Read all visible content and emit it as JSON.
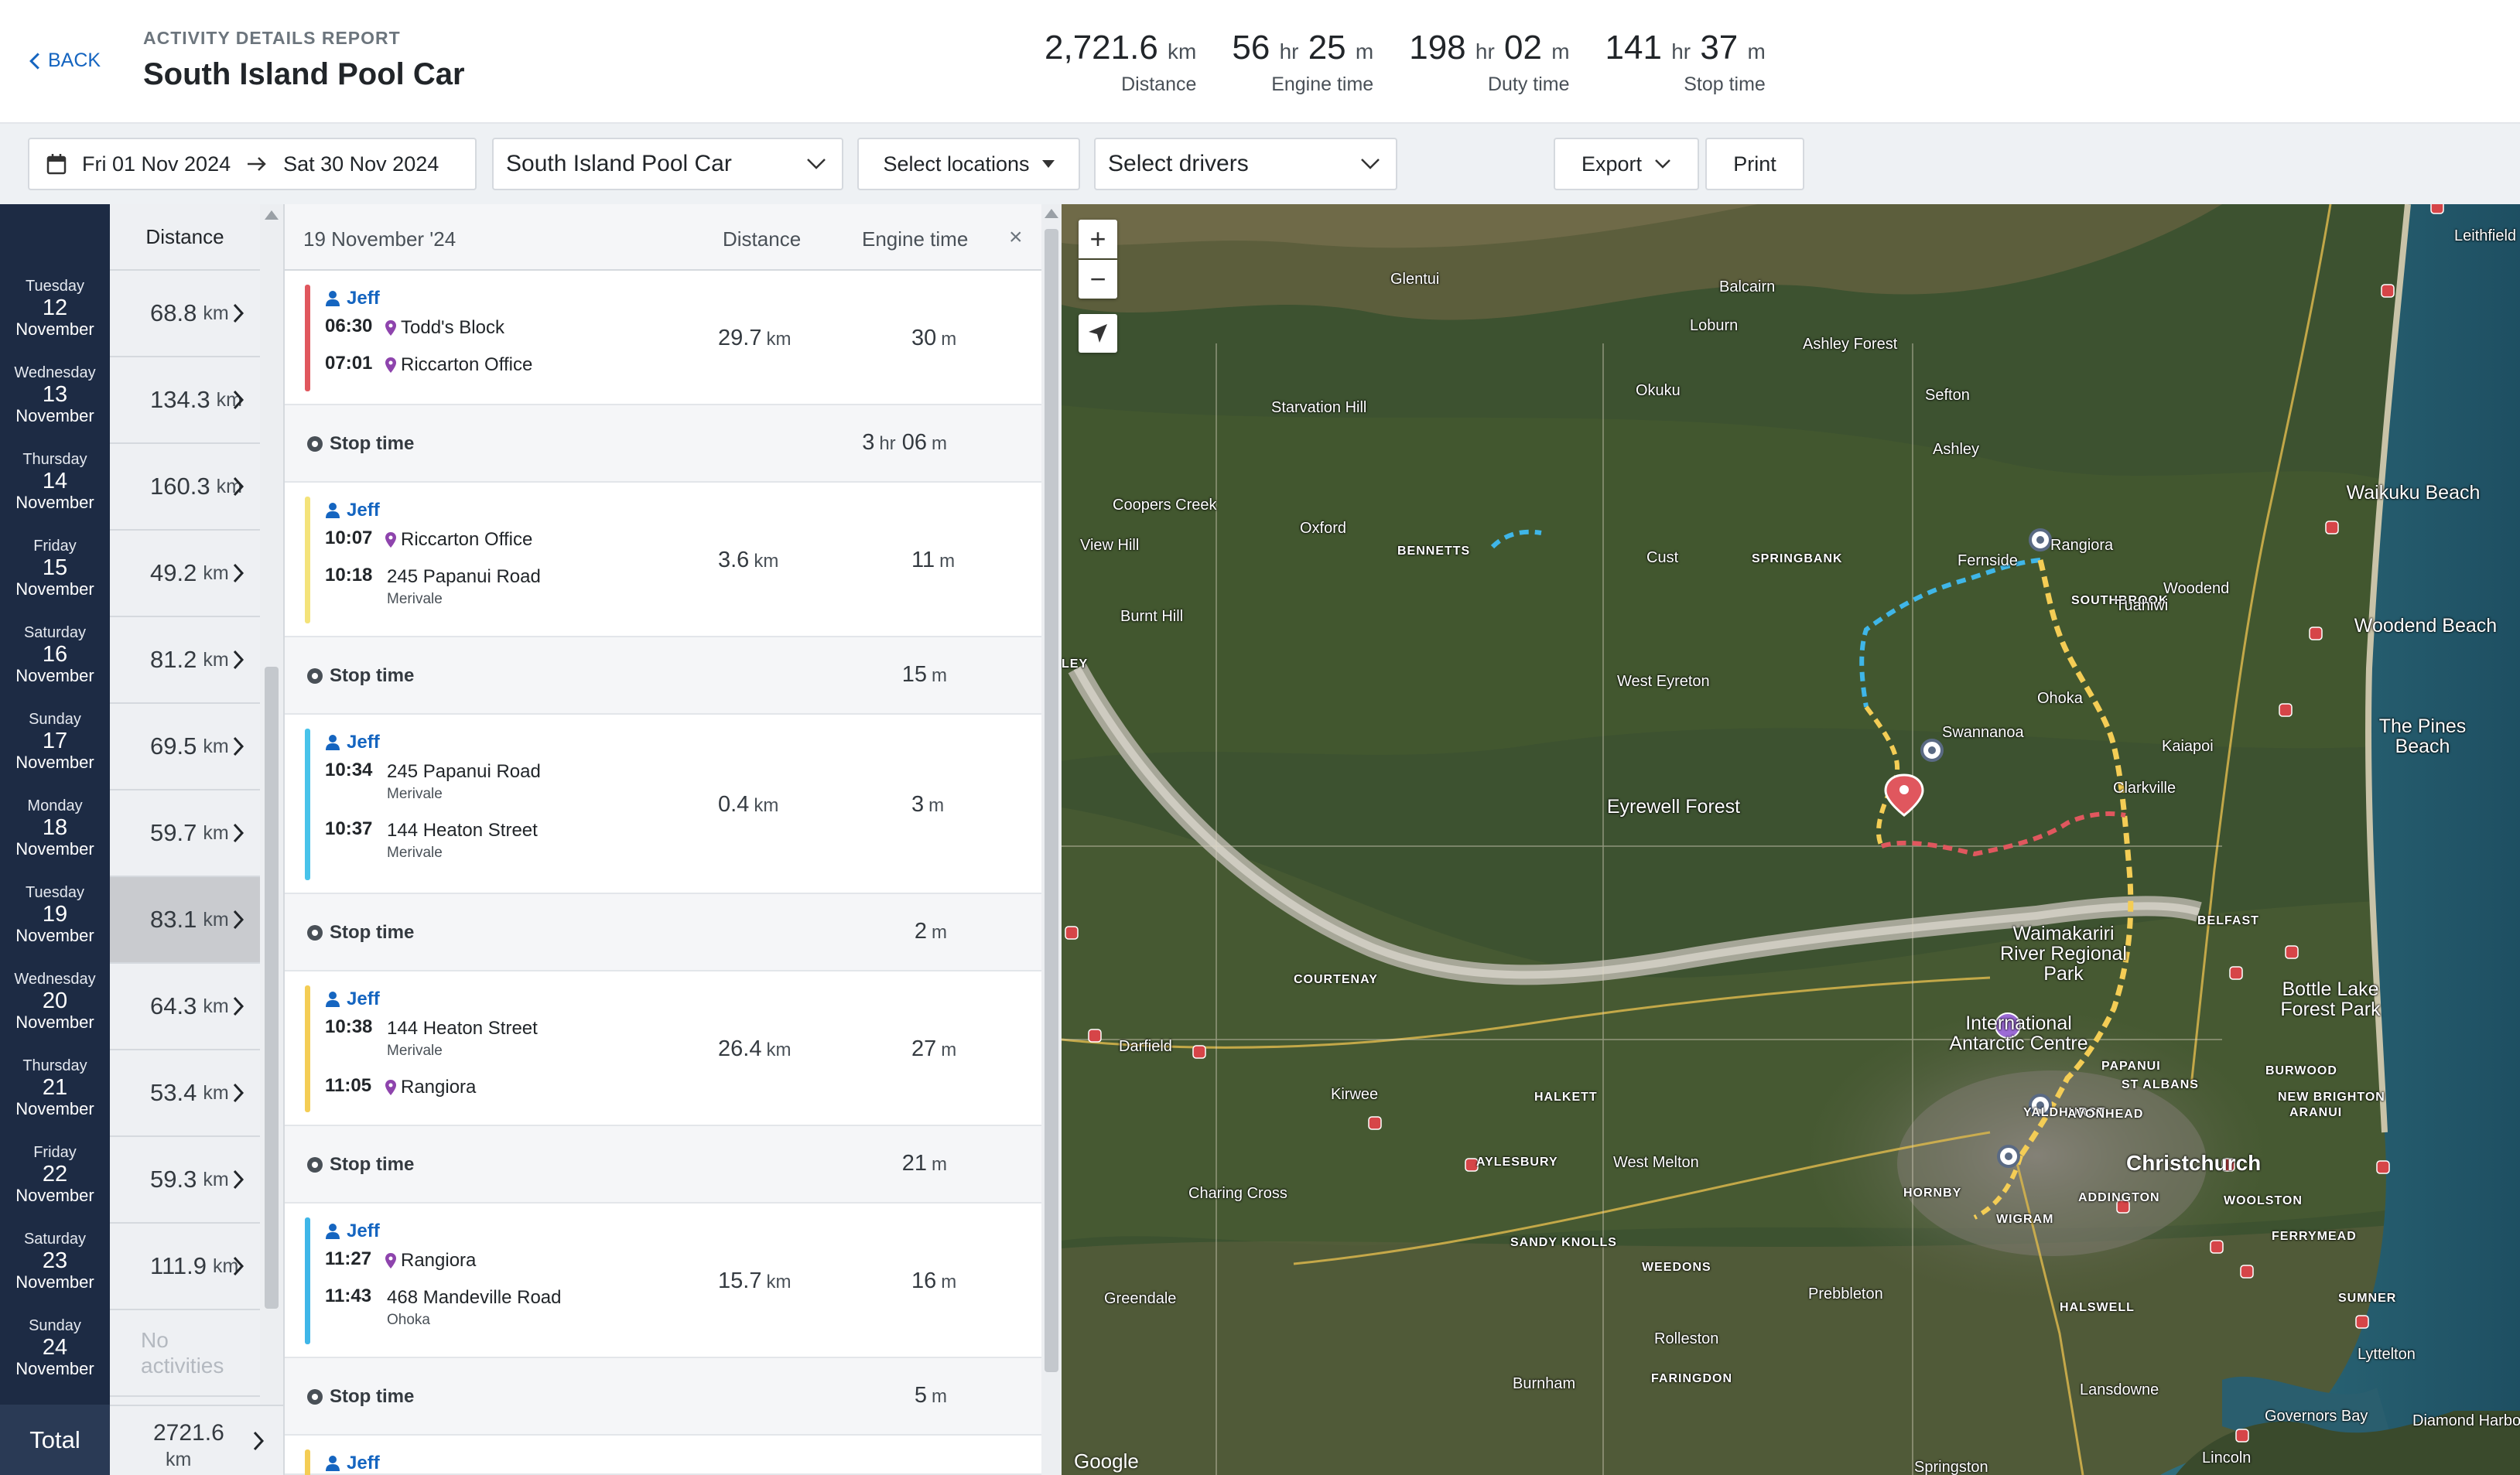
{
  "header": {
    "back_label": "BACK",
    "kicker": "ACTIVITY DETAILS REPORT",
    "title": "South Island Pool Car",
    "stats": [
      {
        "value": "2,721.6",
        "unit": "km",
        "label": "Distance"
      },
      {
        "value": "56",
        "unit": "hr",
        "value2": "25",
        "unit2": "m",
        "label": "Engine time"
      },
      {
        "value": "198",
        "unit": "hr",
        "value2": "02",
        "unit2": "m",
        "label": "Duty time"
      },
      {
        "value": "141",
        "unit": "hr",
        "value2": "37",
        "unit2": "m",
        "label": "Stop time"
      }
    ]
  },
  "filters": {
    "date_from": "Fri 01 Nov 2024",
    "date_to": "Sat 30 Nov 2024",
    "vehicle": "South Island Pool Car",
    "locations": "Select locations",
    "drivers": "Select drivers",
    "export": "Export",
    "print": "Print"
  },
  "days": {
    "column_header": "Distance",
    "rows": [
      {
        "weekday": "Tuesday",
        "day": "12",
        "month": "November",
        "value": "68.8",
        "unit": "km"
      },
      {
        "weekday": "Wednesday",
        "day": "13",
        "month": "November",
        "value": "134.3",
        "unit": "km"
      },
      {
        "weekday": "Thursday",
        "day": "14",
        "month": "November",
        "value": "160.3",
        "unit": "km"
      },
      {
        "weekday": "Friday",
        "day": "15",
        "month": "November",
        "value": "49.2",
        "unit": "km"
      },
      {
        "weekday": "Saturday",
        "day": "16",
        "month": "November",
        "value": "81.2",
        "unit": "km"
      },
      {
        "weekday": "Sunday",
        "day": "17",
        "month": "November",
        "value": "69.5",
        "unit": "km"
      },
      {
        "weekday": "Monday",
        "day": "18",
        "month": "November",
        "value": "59.7",
        "unit": "km"
      },
      {
        "weekday": "Tuesday",
        "day": "19",
        "month": "November",
        "value": "83.1",
        "unit": "km"
      },
      {
        "weekday": "Wednesday",
        "day": "20",
        "month": "November",
        "value": "64.3",
        "unit": "km"
      },
      {
        "weekday": "Thursday",
        "day": "21",
        "month": "November",
        "value": "53.4",
        "unit": "km"
      },
      {
        "weekday": "Friday",
        "day": "22",
        "month": "November",
        "value": "59.3",
        "unit": "km"
      },
      {
        "weekday": "Saturday",
        "day": "23",
        "month": "November",
        "value": "111.9",
        "unit": "km"
      },
      {
        "weekday": "Sunday",
        "day": "24",
        "month": "November",
        "value": "No activities",
        "unit": ""
      }
    ],
    "total_label": "Total",
    "total_value": "2721.6",
    "total_unit": "km"
  },
  "trips": {
    "date": "19 November '24",
    "col_distance": "Distance",
    "col_engine": "Engine time",
    "close": "×",
    "stop_label": "Stop time",
    "items": [
      {
        "driver": "Jeff",
        "start_time": "06:30",
        "start_place": "Todd's Block",
        "start_sub": "",
        "end_time": "07:01",
        "end_place": "Riccarton Office",
        "end_sub": "",
        "distance": "29.7",
        "dist_unit": "km",
        "engine": "30",
        "engine_unit": "m",
        "color": "#e0575e"
      },
      {
        "driver": "Jeff",
        "start_time": "10:07",
        "start_place": "Riccarton Office",
        "start_sub": "",
        "end_time": "10:18",
        "end_place": "245 Papanui Road",
        "end_sub": "Merivale",
        "distance": "3.6",
        "dist_unit": "km",
        "engine": "11",
        "engine_unit": "m",
        "color": "#f4e37a"
      },
      {
        "driver": "Jeff",
        "start_time": "10:34",
        "start_place": "245 Papanui Road",
        "start_sub": "Merivale",
        "end_time": "10:37",
        "end_place": "144 Heaton Street",
        "end_sub": "Merivale",
        "distance": "0.4",
        "dist_unit": "km",
        "engine": "3",
        "engine_unit": "m",
        "color": "#48c3ea"
      },
      {
        "driver": "Jeff",
        "start_time": "10:38",
        "start_place": "144 Heaton Street",
        "start_sub": "Merivale",
        "end_time": "11:05",
        "end_place": "Rangiora",
        "end_sub": "",
        "distance": "26.4",
        "dist_unit": "km",
        "engine": "27",
        "engine_unit": "m",
        "color": "#f4cd55"
      },
      {
        "driver": "Jeff",
        "start_time": "11:27",
        "start_place": "Rangiora",
        "start_sub": "",
        "end_time": "11:43",
        "end_place": "468 Mandeville Road",
        "end_sub": "Ohoka",
        "distance": "15.7",
        "dist_unit": "km",
        "engine": "16",
        "engine_unit": "m",
        "color": "#3fb6e8"
      }
    ],
    "stops": [
      {
        "hr": "3",
        "hr_unit": "hr",
        "m": "06",
        "m_unit": "m"
      },
      {
        "hr": "",
        "hr_unit": "",
        "m": "15",
        "m_unit": "m"
      },
      {
        "hr": "",
        "hr_unit": "",
        "m": "2",
        "m_unit": "m"
      },
      {
        "hr": "",
        "hr_unit": "",
        "m": "21",
        "m_unit": "m"
      },
      {
        "hr": "",
        "hr_unit": "",
        "m": "5",
        "m_unit": "m"
      }
    ],
    "partial_driver": "Jeff",
    "partial_color": "#f4cd55"
  },
  "map": {
    "zoom_in": "+",
    "zoom_out": "−",
    "attribution": "Google",
    "labels": [
      "Leithfield",
      "Glentui",
      "Loburn",
      "Balcairn",
      "Ashley Forest",
      "Okuku",
      "Sefton",
      "Starvation Hill",
      "Ashley",
      "Coopers Creek",
      "Oxford",
      "Waikuku Beach",
      "View Hill",
      "BENNETTS",
      "Cust",
      "SPRINGBANK",
      "Fernside",
      "Rangiora",
      "SOUTHBROOK",
      "Tuahiwi",
      "Woodend",
      "Burnt Hill",
      "Woodend Beach",
      "West Eyreton",
      "Ohoka",
      "Swannanoa",
      "Kaiapoi",
      "The Pines Beach",
      "Clarkville",
      "Eyrewell Forest",
      "BELFAST",
      "Waimakariri River Regional Park",
      "COURTENAY",
      "Bottle Lake Forest Park",
      "International Antarctic Centre",
      "Darfield",
      "PAPANUI",
      "BURWOOD",
      "ST ALBANS",
      "NEW BRIGHTON",
      "Kirwee",
      "HALKETT",
      "YALDHURST",
      "AVONHEAD",
      "ARANUI",
      "AYLESBURY",
      "West Melton",
      "Christchurch",
      "Charing Cross",
      "HORNBY",
      "ADDINGTON",
      "WOOLSTON",
      "WIGRAM",
      "FERRYMEAD",
      "SANDY KNOLLS",
      "WEEDONS",
      "Prebbleton",
      "Greendale",
      "HALSWELL",
      "SUMNER",
      "Rolleston",
      "Lyttelton",
      "FARINGDON",
      "Burnham",
      "Lansdowne",
      "Governors Bay",
      "Diamond Harbour",
      "Lincoln",
      "Springston",
      "LEY"
    ]
  }
}
